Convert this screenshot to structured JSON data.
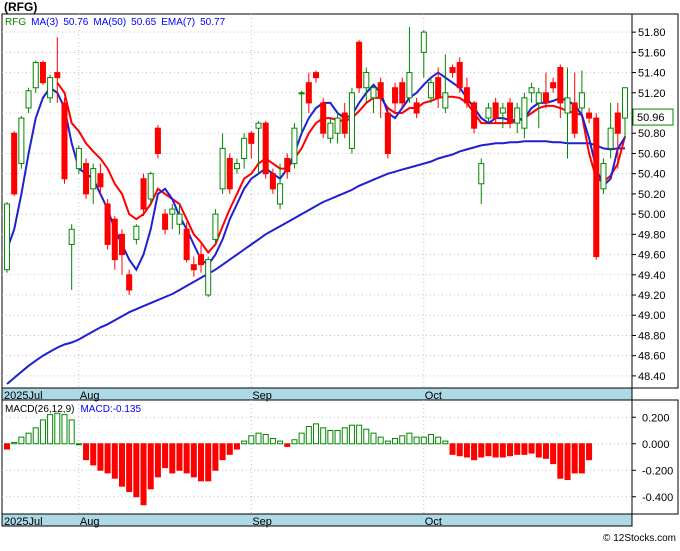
{
  "chart_data": {
    "type": "candlestick",
    "title": "(RFG)",
    "credit": "© 12Stocks.com",
    "price_panel": {
      "ylim": [
        48.3,
        51.92
      ],
      "yticks": [
        "51.80",
        "51.60",
        "51.40",
        "51.20",
        "51.00",
        "50.80",
        "50.60",
        "50.40",
        "50.20",
        "50.00",
        "49.80",
        "49.60",
        "49.40",
        "49.20",
        "49.00",
        "48.80",
        "48.60",
        "48.40"
      ],
      "last_price_label": "50.96",
      "legend": [
        {
          "text": "RFG",
          "color": "#008800"
        },
        {
          "text": "MA(3)",
          "color": "#0000ff"
        },
        {
          "text": "50.76",
          "color": "#0000ff"
        },
        {
          "text": "MA(50)",
          "color": "#0000ff"
        },
        {
          "text": "50.65",
          "color": "#0000ff"
        },
        {
          "text": "EMA(7)",
          "color": "#0000ff"
        },
        {
          "text": "50.77",
          "color": "#0000ff"
        }
      ],
      "candles": [
        [
          49.45,
          50.1,
          49.42,
          50.12
        ],
        [
          50.8,
          50.2,
          50.18,
          50.82
        ],
        [
          50.5,
          50.95,
          50.45,
          50.97
        ],
        [
          51.05,
          51.22,
          51.0,
          51.25
        ],
        [
          51.25,
          51.5,
          51.2,
          51.52
        ],
        [
          51.5,
          51.3,
          51.28,
          51.52
        ],
        [
          51.15,
          51.35,
          51.1,
          51.38
        ],
        [
          51.4,
          51.35,
          51.1,
          51.75
        ],
        [
          51.1,
          50.35,
          50.3,
          51.15
        ],
        [
          49.7,
          49.85,
          49.25,
          49.9
        ],
        [
          50.45,
          50.65,
          50.4,
          50.68
        ],
        [
          50.5,
          50.2,
          50.15,
          50.55
        ],
        [
          50.25,
          50.45,
          50.1,
          50.5
        ],
        [
          50.4,
          50.27,
          50.2,
          50.5
        ],
        [
          50.1,
          49.7,
          49.65,
          50.15
        ],
        [
          49.95,
          49.55,
          49.45,
          49.98
        ],
        [
          49.8,
          49.6,
          49.4,
          49.85
        ],
        [
          49.4,
          49.25,
          49.2,
          49.45
        ],
        [
          49.75,
          49.88,
          49.7,
          49.9
        ],
        [
          50.35,
          50.05,
          49.98,
          50.4
        ],
        [
          50.15,
          50.4,
          50.1,
          50.42
        ],
        [
          50.85,
          50.6,
          50.55,
          50.88
        ],
        [
          50.0,
          49.85,
          49.8,
          50.05
        ],
        [
          50.0,
          50.05,
          49.85,
          50.1
        ],
        [
          49.9,
          50.0,
          49.8,
          50.1
        ],
        [
          49.85,
          49.55,
          49.52,
          49.92
        ],
        [
          49.5,
          49.45,
          49.38,
          49.58
        ],
        [
          49.6,
          49.5,
          49.42,
          49.7
        ],
        [
          49.2,
          49.55,
          49.18,
          49.58
        ],
        [
          49.75,
          50.0,
          49.7,
          50.05
        ],
        [
          50.25,
          50.65,
          50.2,
          50.8
        ],
        [
          50.55,
          50.25,
          50.2,
          50.6
        ],
        [
          50.45,
          50.5,
          50.4,
          50.55
        ],
        [
          50.55,
          50.75,
          50.45,
          50.8
        ],
        [
          50.8,
          50.7,
          50.55,
          50.82
        ],
        [
          50.85,
          50.9,
          50.4,
          50.92
        ],
        [
          50.9,
          50.4,
          50.35,
          50.92
        ],
        [
          50.4,
          50.25,
          50.2,
          50.45
        ],
        [
          50.1,
          50.3,
          50.05,
          50.5
        ],
        [
          50.55,
          50.42,
          50.35,
          50.6
        ],
        [
          50.5,
          50.85,
          50.45,
          50.9
        ],
        [
          51.2,
          51.2,
          50.8,
          51.22
        ],
        [
          51.3,
          51.1,
          51.0,
          51.4
        ],
        [
          51.4,
          51.35,
          51.3,
          51.42
        ],
        [
          51.1,
          50.8,
          50.75,
          51.15
        ],
        [
          50.75,
          50.9,
          50.7,
          50.95
        ],
        [
          50.8,
          50.95,
          50.7,
          51.0
        ],
        [
          51.0,
          50.8,
          50.75,
          51.1
        ],
        [
          50.65,
          51.2,
          50.6,
          51.25
        ],
        [
          51.7,
          51.25,
          51.2,
          51.72
        ],
        [
          51.25,
          51.4,
          51.1,
          51.45
        ],
        [
          51.15,
          51.25,
          51.0,
          51.28
        ],
        [
          51.3,
          51.15,
          50.95,
          51.35
        ],
        [
          51.0,
          50.6,
          50.55,
          51.05
        ],
        [
          51.25,
          51.1,
          51.0,
          51.3
        ],
        [
          51.3,
          51.1,
          51.05,
          51.35
        ],
        [
          51.15,
          51.4,
          51.1,
          51.85
        ],
        [
          51.1,
          51.0,
          50.95,
          51.15
        ],
        [
          51.6,
          51.8,
          51.35,
          51.82
        ],
        [
          51.15,
          51.3,
          51.1,
          51.35
        ],
        [
          51.35,
          51.15,
          51.05,
          51.45
        ],
        [
          51.05,
          51.2,
          51.0,
          51.58
        ],
        [
          51.45,
          51.4,
          51.35,
          51.48
        ],
        [
          51.5,
          51.25,
          51.2,
          51.55
        ],
        [
          51.25,
          51.1,
          51.05,
          51.35
        ],
        [
          51.1,
          50.85,
          50.8,
          51.12
        ],
        [
          50.3,
          50.5,
          50.1,
          50.55
        ],
        [
          50.95,
          51.05,
          50.9,
          51.1
        ],
        [
          51.1,
          50.95,
          50.9,
          51.15
        ],
        [
          51.0,
          51.05,
          50.85,
          51.1
        ],
        [
          51.1,
          50.9,
          50.85,
          51.15
        ],
        [
          50.9,
          51.05,
          50.8,
          51.1
        ],
        [
          50.85,
          51.15,
          50.75,
          51.2
        ],
        [
          51.2,
          51.25,
          51.1,
          51.3
        ],
        [
          51.1,
          51.2,
          50.85,
          51.25
        ],
        [
          51.2,
          51.1,
          51.05,
          51.4
        ],
        [
          51.3,
          51.25,
          51.2,
          51.35
        ],
        [
          51.45,
          51.1,
          50.95,
          51.48
        ],
        [
          51.0,
          51.15,
          50.55,
          51.45
        ],
        [
          51.1,
          50.8,
          50.75,
          51.4
        ],
        [
          51.05,
          51.2,
          51.0,
          51.42
        ],
        [
          51.0,
          50.95,
          50.9,
          51.05
        ],
        [
          50.95,
          49.58,
          49.55,
          51.0
        ],
        [
          50.25,
          50.5,
          50.2,
          50.55
        ],
        [
          50.65,
          50.85,
          50.55,
          51.1
        ],
        [
          51.0,
          50.8,
          50.45,
          51.1
        ],
        [
          50.95,
          51.25,
          50.75,
          51.25
        ]
      ],
      "ma3": [
        49.65,
        49.85,
        50.2,
        50.6,
        50.95,
        51.15,
        51.25,
        51.2,
        51.05,
        50.7,
        50.45,
        50.4,
        50.35,
        50.2,
        50.05,
        49.85,
        49.7,
        49.55,
        49.45,
        49.6,
        49.85,
        50.2,
        50.25,
        50.15,
        49.98,
        49.85,
        49.7,
        49.55,
        49.5,
        49.6,
        49.75,
        49.95,
        50.1,
        50.25,
        50.35,
        50.4,
        50.45,
        50.4,
        50.35,
        50.45,
        50.6,
        50.8,
        50.95,
        51.05,
        51.1,
        51.1,
        51.0,
        50.95,
        50.98,
        51.1,
        51.2,
        51.28,
        51.2,
        51.0,
        50.95,
        51.05,
        51.15,
        51.2,
        51.28,
        51.35,
        51.4,
        51.35,
        51.3,
        51.25,
        51.15,
        51.05,
        50.95,
        50.9,
        50.95,
        50.95,
        50.93,
        50.93,
        50.95,
        51.05,
        51.1,
        51.1,
        51.12,
        51.15,
        51.12,
        51.08,
        50.98,
        50.75,
        50.45,
        50.28,
        50.35,
        50.65,
        50.76
      ],
      "ema7": [
        null,
        null,
        null,
        null,
        null,
        null,
        null,
        51.3,
        51.2,
        50.9,
        50.82,
        50.7,
        50.62,
        50.55,
        50.45,
        50.3,
        50.2,
        50.0,
        49.95,
        50.0,
        50.1,
        50.25,
        50.2,
        50.15,
        50.1,
        49.95,
        49.8,
        49.72,
        49.62,
        49.7,
        49.88,
        50.05,
        50.2,
        50.35,
        50.4,
        50.5,
        50.55,
        50.5,
        50.45,
        50.45,
        50.55,
        50.65,
        50.8,
        50.9,
        50.95,
        50.95,
        50.93,
        50.92,
        50.95,
        51.02,
        51.1,
        51.15,
        51.15,
        51.05,
        51.0,
        51.0,
        51.05,
        51.05,
        51.1,
        51.12,
        51.15,
        51.16,
        51.16,
        51.15,
        51.1,
        51.0,
        50.9,
        50.9,
        50.9,
        50.9,
        50.9,
        50.92,
        50.95,
        51.0,
        51.05,
        51.07,
        51.07,
        51.05,
        51.02,
        51.0,
        50.98,
        50.6,
        50.35,
        50.32,
        50.38,
        50.5,
        50.77
      ],
      "ma50": [
        48.32,
        48.38,
        48.44,
        48.5,
        48.55,
        48.6,
        48.64,
        48.68,
        48.71,
        48.73,
        48.76,
        48.8,
        48.84,
        48.88,
        48.91,
        48.95,
        48.99,
        49.03,
        49.06,
        49.09,
        49.12,
        49.15,
        49.18,
        49.21,
        49.25,
        49.29,
        49.33,
        49.37,
        49.41,
        49.45,
        49.5,
        49.55,
        49.6,
        49.65,
        49.7,
        49.75,
        49.8,
        49.84,
        49.88,
        49.92,
        49.96,
        50.0,
        50.04,
        50.08,
        50.12,
        50.15,
        50.18,
        50.21,
        50.24,
        50.28,
        50.31,
        50.34,
        50.37,
        50.4,
        50.42,
        50.44,
        50.46,
        50.48,
        50.5,
        50.52,
        50.55,
        50.57,
        50.59,
        50.62,
        50.64,
        50.66,
        50.68,
        50.69,
        50.7,
        50.7,
        50.71,
        50.71,
        50.72,
        50.72,
        50.72,
        50.72,
        50.71,
        50.71,
        50.7,
        50.7,
        50.7,
        50.7,
        50.68,
        50.65,
        50.64,
        50.65,
        50.65
      ]
    },
    "macd_panel": {
      "label": "MACD(26,12,9)",
      "value_label": "MACD:-0.135",
      "ylim": [
        -0.5,
        0.3
      ],
      "yticks": [
        "0.200",
        "0.000",
        "-0.200",
        "-0.400"
      ],
      "histogram": [
        -0.04,
        0.01,
        0.05,
        0.08,
        0.12,
        0.18,
        0.22,
        0.23,
        0.22,
        0.18,
        0.0,
        -0.12,
        -0.16,
        -0.2,
        -0.22,
        -0.26,
        -0.32,
        -0.36,
        -0.4,
        -0.46,
        -0.34,
        -0.25,
        -0.18,
        -0.22,
        -0.2,
        -0.22,
        -0.25,
        -0.28,
        -0.28,
        -0.2,
        -0.12,
        -0.08,
        -0.04,
        0.02,
        0.06,
        0.08,
        0.07,
        0.04,
        0.02,
        -0.02,
        0.03,
        0.08,
        0.13,
        0.15,
        0.12,
        0.1,
        0.1,
        0.12,
        0.14,
        0.14,
        0.11,
        0.08,
        0.05,
        0.02,
        0.04,
        0.06,
        0.08,
        0.05,
        0.05,
        0.07,
        0.05,
        0.02,
        -0.08,
        -0.09,
        -0.1,
        -0.12,
        -0.1,
        -0.09,
        -0.1,
        -0.1,
        -0.09,
        -0.08,
        -0.08,
        -0.07,
        -0.1,
        -0.11,
        -0.15,
        -0.26,
        -0.27,
        -0.22,
        -0.22,
        -0.12
      ]
    },
    "x_labels": [
      {
        "text": "2025Jul",
        "index": 0
      },
      {
        "text": "Aug",
        "index": 10
      },
      {
        "text": "Sep",
        "index": 34
      },
      {
        "text": "Oct",
        "index": 58
      }
    ],
    "colors": {
      "up": "#008800",
      "down": "#ff0000",
      "ma3": "#1f1fd4",
      "ema7": "#ff0000",
      "ma50": "#1f1fd4",
      "axis_band": "#add8e6",
      "grid": "#c0c0c0"
    }
  }
}
